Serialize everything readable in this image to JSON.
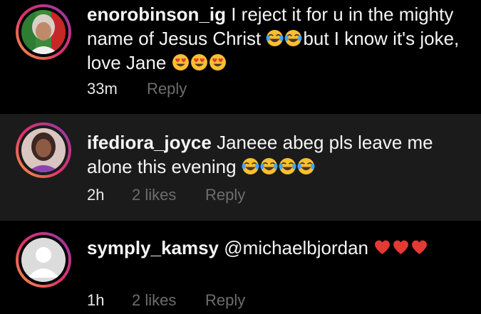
{
  "comments": [
    {
      "username": "enorobinson_ig",
      "text_parts": [
        "I reject it for u in the mighty name of Jesus Christ ",
        "but I know it's joke, love Jane "
      ],
      "emoji_groups": [
        {
          "icon": "face-with-tears-of-joy-icon",
          "count": 2
        },
        {
          "icon": "smiling-face-with-heart-eyes-icon",
          "count": 3
        }
      ],
      "time": "33m",
      "likes": "",
      "reply": "Reply"
    },
    {
      "username": "ifediora_joyce",
      "text_parts": [
        "Janeee abeg pls leave me alone this evening "
      ],
      "emoji_groups": [
        {
          "icon": "face-with-tears-of-joy-icon",
          "count": 4
        }
      ],
      "time": "2h",
      "likes": "2 likes",
      "reply": "Reply"
    },
    {
      "username": "symply_kamsy",
      "text_parts": [
        "@michaelbjordan "
      ],
      "emoji_groups": [
        {
          "icon": "red-heart-icon",
          "count": 3
        }
      ],
      "time": "1h",
      "likes": "2 likes",
      "reply": "Reply"
    }
  ],
  "colors": {
    "background": "#000000",
    "highlighted_row": "#1b1b1b",
    "text": "#f5f5f5",
    "secondary": "#6d6d6d",
    "story_ring_start": "#f9a03f",
    "story_ring_end": "#833ab4"
  }
}
